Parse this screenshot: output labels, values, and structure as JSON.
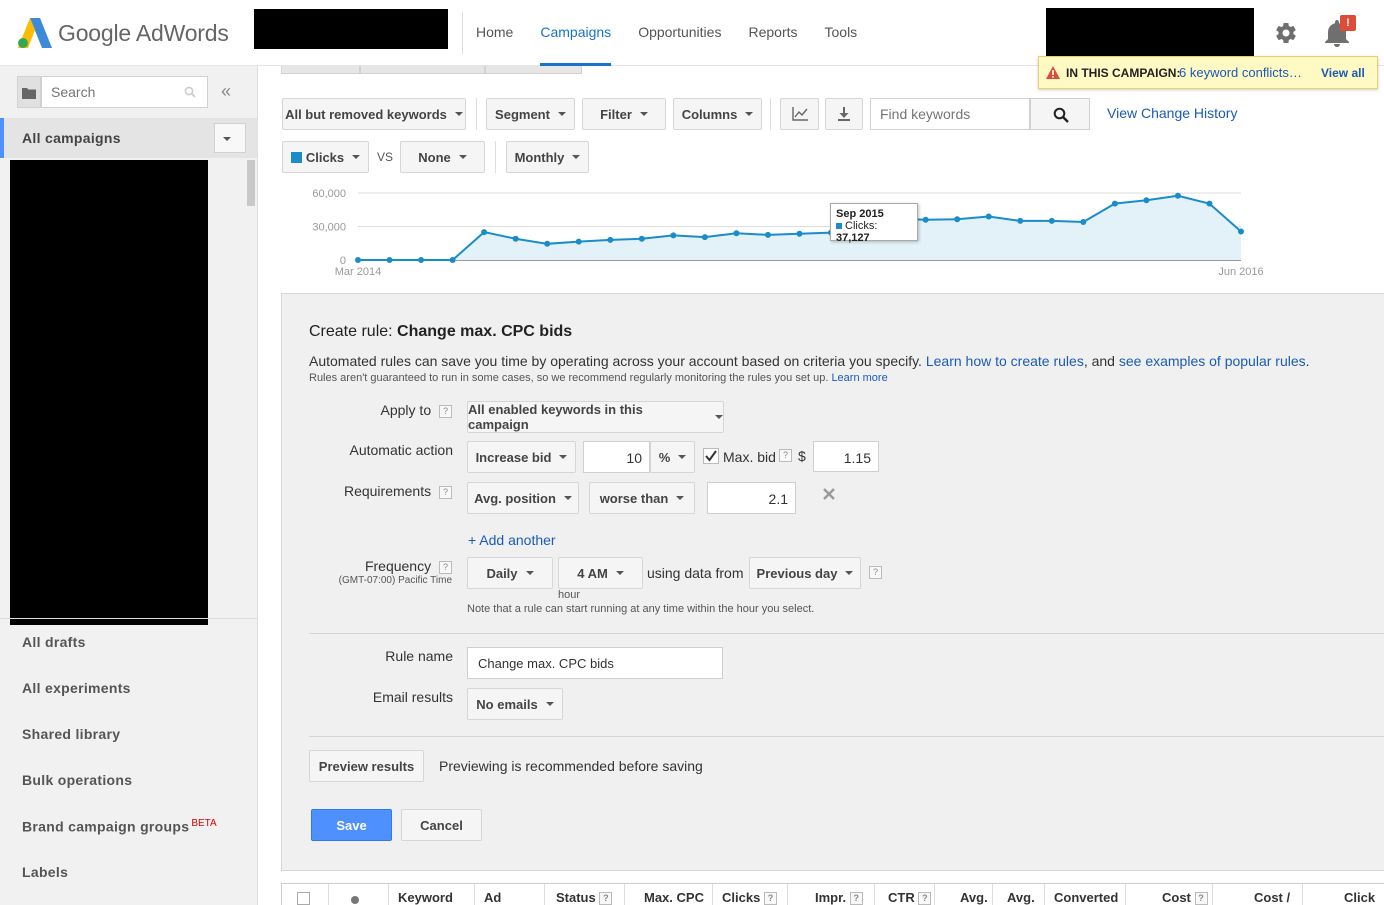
{
  "app": {
    "name": "Google AdWords"
  },
  "topnav": {
    "items": [
      {
        "label": "Home"
      },
      {
        "label": "Campaigns"
      },
      {
        "label": "Opportunities"
      },
      {
        "label": "Reports"
      },
      {
        "label": "Tools"
      }
    ],
    "active": "Campaigns"
  },
  "notifications": {
    "badge": "!"
  },
  "alert": {
    "label": "IN THIS CAMPAIGN:",
    "message": "6 keyword conflicts…",
    "view_all": "View all"
  },
  "sidebar": {
    "search_placeholder": "Search",
    "collapse": "«",
    "all_campaigns": "All campaigns",
    "items": [
      {
        "label": "All drafts"
      },
      {
        "label": "All experiments"
      },
      {
        "label": "Shared library"
      },
      {
        "label": "Bulk operations"
      },
      {
        "label": "Brand campaign groups"
      },
      {
        "label": "Labels"
      }
    ],
    "beta": "BETA"
  },
  "toolbar": {
    "keyword_filter": "All but removed keywords",
    "segment": "Segment",
    "filter": "Filter",
    "columns": "Columns",
    "find_placeholder": "Find keywords",
    "view_change_history": "View Change History",
    "metric1": "Clicks",
    "vs": "VS",
    "metric2": "None",
    "period": "Monthly"
  },
  "chart_data": {
    "type": "area",
    "x_start": "Mar 2014",
    "x_end": "Jun 2016",
    "y_ticks": [
      "60,000",
      "30,000",
      "0"
    ],
    "ylim": [
      0,
      60000
    ],
    "series": [
      {
        "name": "Clicks",
        "color": "#1a8cc9",
        "values": [
          0,
          0,
          0,
          0,
          25000,
          19000,
          14500,
          16500,
          18000,
          19000,
          22000,
          20500,
          24000,
          22500,
          23500,
          24500,
          27000,
          37127,
          36000,
          36500,
          39000,
          35000,
          35000,
          34000,
          50500,
          53500,
          57500,
          50500,
          25500
        ]
      }
    ],
    "tooltip": {
      "month": "Sep 2015",
      "label": "Clicks:",
      "value": "37,127"
    }
  },
  "rule": {
    "title_prefix": "Create rule:",
    "title_name": "Change max. CPC bids",
    "desc_part1": "Automated rules can save you time by operating across your account based on criteria you specify.",
    "desc_link1": "Learn how to create rules",
    "desc_part2": ", and",
    "desc_link2": "see examples of popular rules",
    "desc_part3": ".",
    "note": "Rules aren't guaranteed to run in some cases, so we recommend regularly monitoring the rules you set up.",
    "note_link": "Learn more",
    "apply_to_label": "Apply to",
    "apply_to_value": "All enabled keywords in this campaign",
    "action_label": "Automatic action",
    "action_value": "Increase bid",
    "action_amount": "10",
    "action_unit": "%",
    "max_bid_label": "Max. bid",
    "max_bid_checked": true,
    "currency": "$",
    "max_bid_value": "1.15",
    "req_label": "Requirements",
    "req_metric": "Avg. position",
    "req_operator": "worse than",
    "req_value": "2.1",
    "add_another": "+ Add another",
    "freq_label": "Frequency",
    "timezone": "(GMT-07:00) Pacific Time",
    "freq_value": "Daily",
    "freq_hour": "4 AM",
    "hour_caption": "hour",
    "using_data": "using data from",
    "data_range": "Previous day",
    "freq_note": "Note that a rule can start running at any time within the hour you select.",
    "name_label": "Rule name",
    "name_value": "Change max. CPC bids",
    "email_label": "Email results",
    "email_value": "No emails",
    "preview_button": "Preview results",
    "preview_note": "Previewing is recommended before saving",
    "save_button": "Save",
    "cancel_button": "Cancel",
    "help": "?"
  },
  "table": {
    "headers": [
      "Keyword",
      "Ad",
      "Status",
      "Max. CPC",
      "Clicks",
      "Impr.",
      "CTR",
      "Avg.",
      "Avg.",
      "Converted",
      "Cost",
      "Cost /",
      "Click"
    ]
  }
}
